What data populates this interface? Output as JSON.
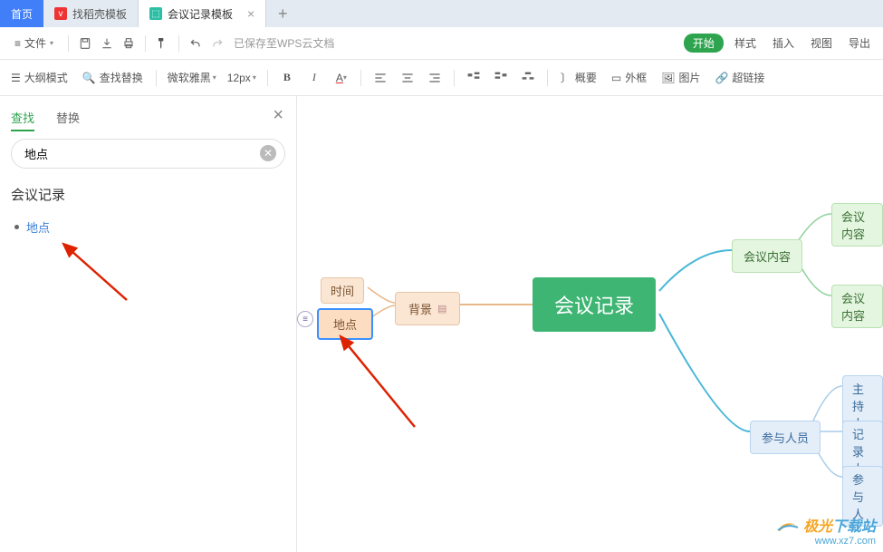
{
  "tabs": {
    "home": "首页",
    "t1": "找稻壳模板",
    "t2": "会议记录模板",
    "plus": "+"
  },
  "filebar": {
    "menu": "文件",
    "status": "已保存至WPS云文档",
    "start": "开始",
    "style": "样式",
    "insert": "插入",
    "view": "视图",
    "export": "导出"
  },
  "toolbar": {
    "outline": "大纲模式",
    "find": "查找替换",
    "font": "微软雅黑",
    "size": "12px",
    "summary": "概要",
    "border": "外框",
    "image": "图片",
    "link": "超链接"
  },
  "sidebar": {
    "tab_find": "查找",
    "tab_replace": "替换",
    "search_value": "地点",
    "result_title": "会议记录",
    "result_item": "地点"
  },
  "mindmap": {
    "root": "会议记录",
    "n_time": "时间",
    "n_place": "地点",
    "n_bg": "背景",
    "n_content": "会议内容",
    "n_c1": "会议内容",
    "n_c2": "会议内容",
    "n_people": "参与人员",
    "n_p1": "主持人",
    "n_p2": "记录人",
    "n_p3": "参与人"
  },
  "watermark": {
    "brand1": "极光",
    "brand2": "下载站",
    "url": "www.xz7.com"
  }
}
